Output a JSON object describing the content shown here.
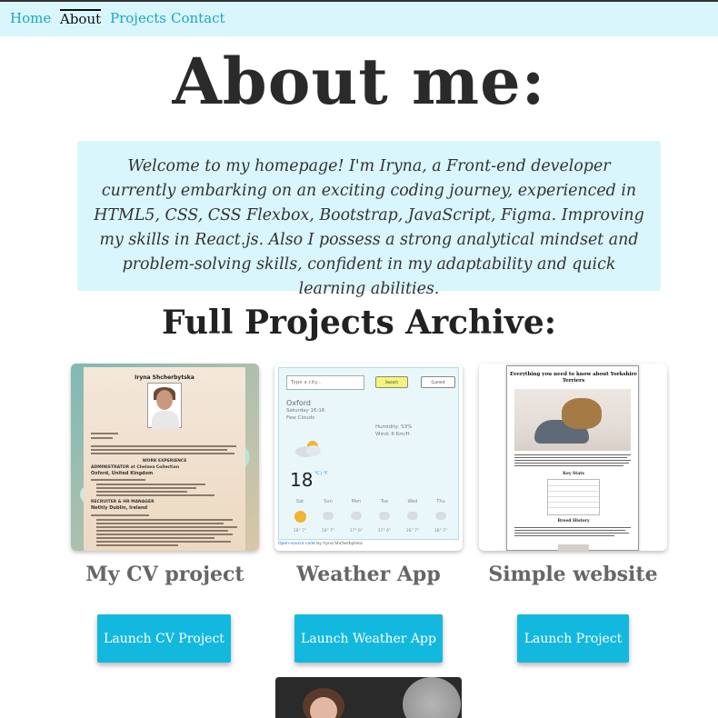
{
  "nav": {
    "items": [
      {
        "label": "Home",
        "active": false
      },
      {
        "label": "About",
        "active": true
      },
      {
        "label": "Projects",
        "active": false
      },
      {
        "label": "Contact",
        "active": false
      }
    ]
  },
  "header": {
    "title": "About me:"
  },
  "intro": {
    "text": "Welcome to my homepage! I'm Iryna, a Front-end developer currently embarking on an exciting coding journey, experienced in HTML5, CSS, CSS Flexbox, Bootstrap, JavaScript, Figma. Improving my skills in React.js. Also I possess a strong analytical mindset and problem-solving skills, confident in my adaptability and quick learning abilities."
  },
  "projects": {
    "heading": "Full Projects Archive:",
    "items": [
      {
        "title": "My CV project",
        "button": "Launch CV Project",
        "preview": {
          "name": "Iryna Shcherbytska",
          "section1": "WORK EXPERIENCE",
          "role1": "ADMINISTRATOR at Chelsea Collection",
          "place1": "Oxford, United Kingdom",
          "role2": "RECRUITER & HR MANAGER",
          "place2": "Nethly Dublin, Ireland"
        }
      },
      {
        "title": "Weather App",
        "button": "Launch Weather App",
        "preview": {
          "placeholder": "Type a city...",
          "search": "Search",
          "current": "Current",
          "city": "Oxford",
          "datetime": "Saturday 16:16",
          "description": "Few Clouds",
          "humidity": "Humidity: 53%",
          "wind": "Wind: 6 Km/H",
          "temp": "18",
          "units": "°C | °F",
          "days": [
            "Sat",
            "Sun",
            "Mon",
            "Tue",
            "Wed",
            "Thu"
          ],
          "day_temps": [
            "18° 7°",
            "16° 7°",
            "17° 6°",
            "17° 6°",
            "16° 7°",
            "18° 7°"
          ],
          "credit_link": "Open-source code",
          "credit_text": " by Iryna Shcherbytska"
        }
      },
      {
        "title": "Simple website",
        "button": "Launch Project",
        "preview": {
          "title": "Everything you need to know about Yorkshire Terriers",
          "stats_heading": "Key Stats",
          "history_heading": "Breed History"
        }
      }
    ]
  },
  "colors": {
    "nav_bg": "#d9f6fc",
    "link": "#1aa6c4",
    "button": "#13b8df",
    "intro_bg": "#d9f6fc"
  }
}
